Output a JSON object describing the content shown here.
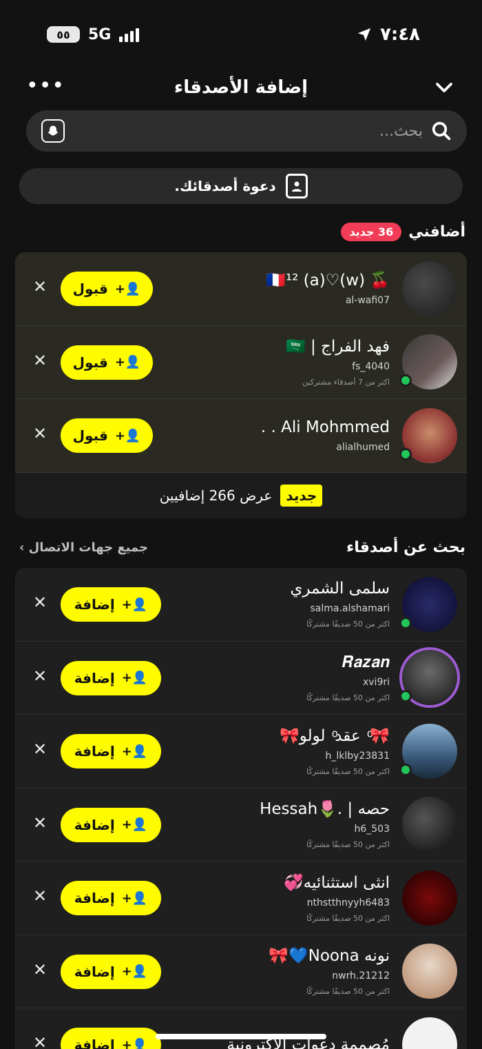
{
  "status": {
    "battery": "٥٥",
    "network": "5G",
    "time": "٧:٤٨"
  },
  "nav": {
    "title": "إضافة الأصدقاء",
    "more": "•••"
  },
  "search": {
    "placeholder": "بحث..."
  },
  "invite": {
    "label": "دعوة أصدقائك."
  },
  "added_me": {
    "title": "أضافني",
    "badge": "36 جديد",
    "accept_label": "قبول",
    "rows": [
      {
        "name": "🍒 🇫🇷¹² (a)♡(w)",
        "username": "al-wafi07",
        "sub": ""
      },
      {
        "name": "فهد الفراج | 🇸🇦",
        "username": "fs_4040",
        "sub": "اكثر من 7 أصدقاء مشتركين"
      },
      {
        "name": "Ali Mohmmed . .",
        "username": "alialhumed",
        "sub": ""
      }
    ],
    "view_more_badge": "جديد",
    "view_more_text": "عرض 266 إضافيين"
  },
  "find_friends": {
    "title": "بحث عن أصدقاء",
    "all_contacts": "جميع جهات الاتصال ›",
    "add_label": "إضافة",
    "rows": [
      {
        "name": "سلمى الشمري",
        "username": "salma.alshamari",
        "sub": "اكثر من 50 صديقًا مشتركًا"
      },
      {
        "name": "𝑹𝒂𝒛𝒂𝒏",
        "username": "xvi9ri",
        "sub": "اكثر من 50 صديقًا مشتركًا"
      },
      {
        "name": "🎀 ͦ عقد ͦ لولو🎀",
        "username": "h_lklby23831",
        "sub": "اكثر من 50 صديقًا مشتركًا"
      },
      {
        "name": "حصه | .🌷Hessah",
        "username": "h6_503",
        "sub": "اكثر من 50 صديقًا مشتركًا"
      },
      {
        "name": "انثى استثنائيه💞",
        "username": "nthstthnyyh6483",
        "sub": "اكثر من 50 صديقًا مشتركًا"
      },
      {
        "name": "نونه Noona💙🎀",
        "username": "nwrh.21212",
        "sub": "اكثر من 50 صديقًا مشتركًا"
      },
      {
        "name": "مُصممة دعوات الأكترونية",
        "username": "",
        "sub": ""
      }
    ]
  },
  "colors": {
    "accent_yellow": "#fffc00",
    "badge_red": "#f23c57",
    "online_green": "#22c65a"
  }
}
